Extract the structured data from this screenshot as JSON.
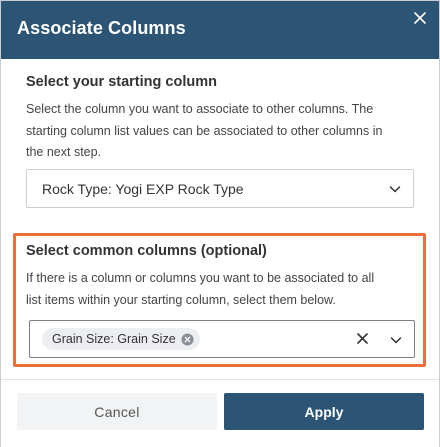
{
  "dialog": {
    "title": "Associate Columns",
    "close_icon": "close-icon"
  },
  "starting_column": {
    "heading": "Select your starting column",
    "description_lines": [
      "Select the column you want to associate to other columns. The",
      "starting column list values can be associated to other columns in",
      "the next step."
    ],
    "selected_value": "Rock Type: Yogi EXP Rock Type"
  },
  "common_columns": {
    "heading": "Select common columns (optional)",
    "description_lines": [
      "If there is a column or columns you want to be associated to all",
      "list items within your starting column, select them below."
    ],
    "selected_chips": [
      {
        "label": "Grain Size: Grain Size"
      }
    ]
  },
  "footer": {
    "cancel_label": "Cancel",
    "apply_label": "Apply"
  },
  "colors": {
    "header_bg": "#2c5474",
    "highlight_border": "#e8703f",
    "apply_bg": "#2c5474"
  }
}
